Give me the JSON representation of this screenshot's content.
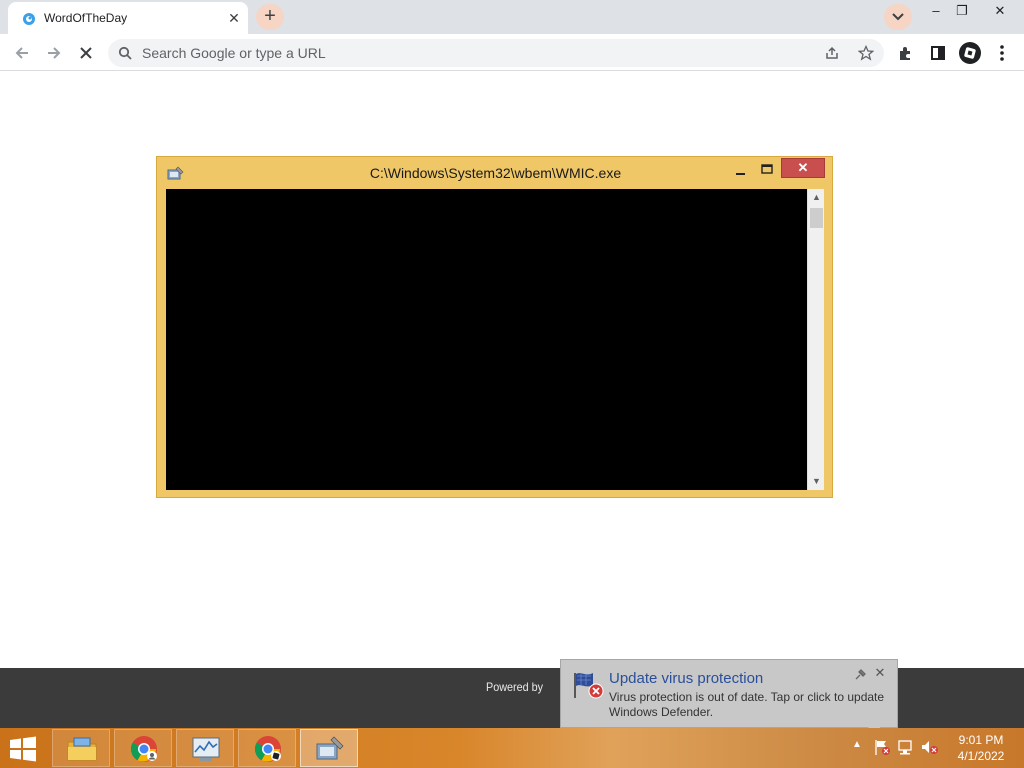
{
  "browser": {
    "tab": {
      "title": "WordOfTheDay",
      "close_glyph": "✕"
    },
    "new_tab_glyph": "+",
    "window_controls": {
      "minimize": "–",
      "restore": "❐",
      "close": "✕"
    },
    "omnibox": {
      "placeholder": "Search Google or type a URL",
      "value": ""
    },
    "toolbar_icons": [
      "back-arrow-icon",
      "forward-arrow-icon",
      "stop-loading-icon",
      "search-icon",
      "share-icon",
      "bookmark-star-icon",
      "extensions-icon",
      "side-panel-icon",
      "profile-avatar-icon",
      "menu-kebab-icon"
    ]
  },
  "wmic_window": {
    "title": "C:\\Windows\\System32\\wbem\\WMIC.exe",
    "close_glyph": "✕",
    "scroll_up_glyph": "▲",
    "scroll_down_glyph": "▼",
    "console_text": ""
  },
  "page_footer": {
    "powered_by": "Powered by"
  },
  "defender_toast": {
    "title": "Update virus protection",
    "body": "Virus protection is out of date. Tap or click to update Windows Defender.",
    "close_glyph": "✕"
  },
  "taskbar": {
    "apps": [
      {
        "name": "file-explorer",
        "active": false
      },
      {
        "name": "chrome",
        "active": false
      },
      {
        "name": "performance-monitor",
        "active": false
      },
      {
        "name": "chrome",
        "active": false
      },
      {
        "name": "wmic-console",
        "active": true
      }
    ],
    "tray_expand_glyph": "▲",
    "clock": {
      "time": "9:01 PM",
      "date": "4/1/2022"
    }
  },
  "colors": {
    "wmic_frame": "#f0c766",
    "wmic_close": "#c94f4f",
    "toast_title": "#2a4f9a",
    "taskbar_accent": "#d9862b",
    "chrome_tab_strip": "#dee1e6"
  }
}
